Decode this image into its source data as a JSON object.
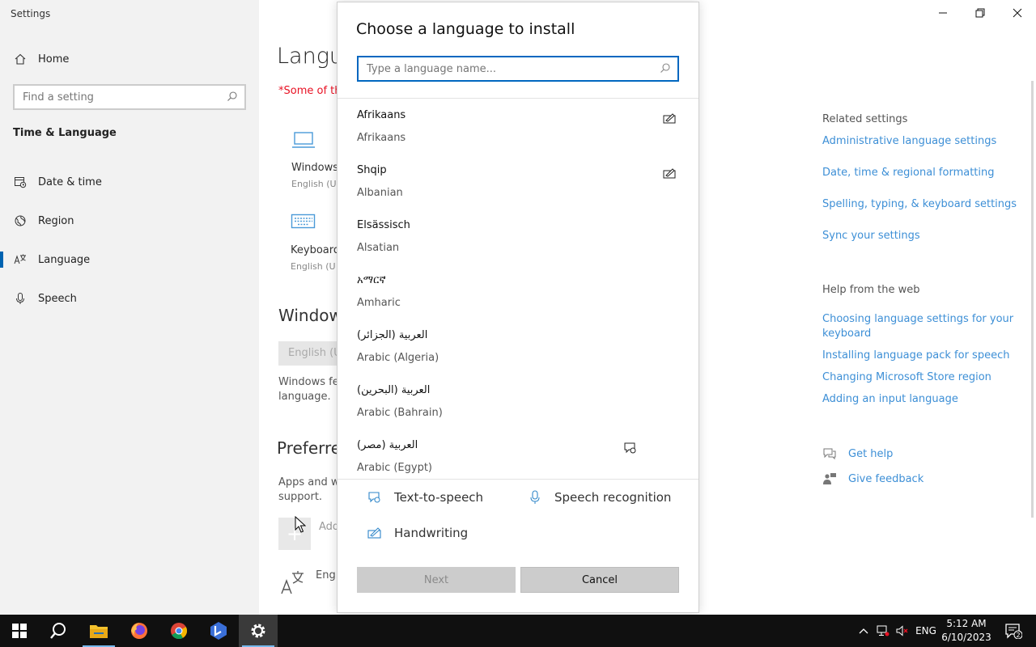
{
  "window": {
    "title": "Settings"
  },
  "sidebar": {
    "home_label": "Home",
    "search_placeholder": "Find a setting",
    "section_label": "Time & Language",
    "items": [
      {
        "label": "Date & time",
        "icon": "calendar-clock-icon"
      },
      {
        "label": "Region",
        "icon": "globe-icon"
      },
      {
        "label": "Language",
        "icon": "language-icon",
        "active": true
      },
      {
        "label": "Speech",
        "icon": "microphone-icon"
      }
    ]
  },
  "main": {
    "title_partial": "Langu",
    "note_partial": "*Some of th",
    "tiles": [
      {
        "title_partial": "Windows",
        "sub_partial": "English (U"
      },
      {
        "title_partial": "Keyboard",
        "sub_partial": "English (U"
      }
    ],
    "windows_heading_partial": "Window",
    "display_lang_partial": "English (U",
    "windows_body_line1": "Windows fe",
    "windows_body_line2": "language.",
    "preferred_heading_partial": "Preferre",
    "preferred_body_line1": "Apps and w",
    "preferred_body_line2": "support.",
    "add_label_partial": "Add",
    "english_partial": "Engl"
  },
  "related": {
    "heading": "Related settings",
    "links": [
      "Administrative language settings",
      "Date, time & regional formatting",
      "Spelling, typing, & keyboard settings",
      "Sync your settings"
    ],
    "help_heading": "Help from the web",
    "help_links": [
      "Choosing language settings for your keyboard",
      "Installing language pack for speech",
      "Changing Microsoft Store region",
      "Adding an input language"
    ],
    "get_help": "Get help",
    "give_feedback": "Give feedback"
  },
  "dialog": {
    "title": "Choose a language to install",
    "search_placeholder": "Type a language name...",
    "languages": [
      {
        "native": "Afrikaans",
        "english": "Afrikaans",
        "features": [
          "handwriting"
        ]
      },
      {
        "native": "Shqip",
        "english": "Albanian",
        "features": [
          "handwriting"
        ]
      },
      {
        "native": "Elsässisch",
        "english": "Alsatian",
        "features": []
      },
      {
        "native": "አማርኛ",
        "english": "Amharic",
        "features": []
      },
      {
        "native": "العربية (الجزائر)",
        "english": "Arabic (Algeria)",
        "features": []
      },
      {
        "native": "العربية (البحرين)",
        "english": "Arabic (Bahrain)",
        "features": []
      },
      {
        "native": "العربية (مصر)",
        "english": "Arabic (Egypt)",
        "features": [
          "text-to-speech"
        ]
      }
    ],
    "legend": {
      "tts": "Text-to-speech",
      "speech": "Speech recognition",
      "handwriting": "Handwriting"
    },
    "next_label": "Next",
    "cancel_label": "Cancel"
  },
  "taskbar": {
    "tray_lang": "ENG",
    "time": "5:12 AM",
    "date": "6/10/2023",
    "notification_count": "2"
  },
  "colors": {
    "accent": "#0067c0",
    "link": "#3d8fd6",
    "sidebar_bg": "#f2f2f2",
    "taskbar_bg": "#101010"
  }
}
